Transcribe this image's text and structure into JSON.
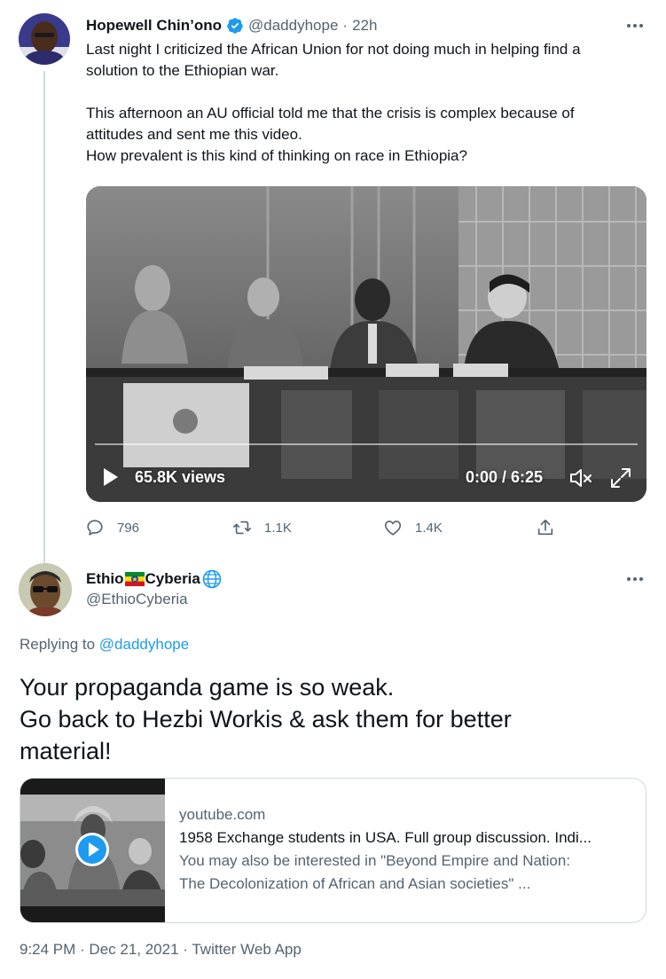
{
  "tweet": {
    "author_name": "Hopewell Chin’ono",
    "handle": "@daddyhope",
    "separator": "·",
    "time": "22h",
    "text_lines": [
      "Last night I criticized the African Union for not doing much in helping find a",
      "solution to the Ethiopian war.",
      "",
      "This afternoon an AU official told me that the crisis is complex because of",
      "attitudes and sent me this video.",
      "How prevalent is this kind of thinking on race in Ethiopia?"
    ],
    "video": {
      "views": "65.8K views",
      "time_display": "0:00 / 6:25"
    },
    "stats": {
      "replies": "796",
      "retweets": "1.1K",
      "likes": "1.4K"
    }
  },
  "reply": {
    "name_part1": "Ethio",
    "name_part2": "Cyberia",
    "handle": "@EthioCyberia",
    "replying_prefix": "Replying to",
    "replying_to": "@daddyhope",
    "text_lines": [
      "Your propaganda game is so weak.",
      "Go back to Hezbi Workis & ask them for better",
      "material!"
    ],
    "card": {
      "domain": "youtube.com",
      "title": "1958 Exchange students in USA. Full group discussion. Indi...",
      "description_lines": [
        "You may also be interested in \"Beyond Empire and Nation:",
        "The Decolonization of African and Asian societies\" ..."
      ]
    },
    "footer": "9:24 PM · Dec 21, 2021 · Twitter Web App"
  },
  "colors": {
    "accent": "#1d9bf0",
    "text_primary": "#0f1419",
    "text_secondary": "#536471",
    "border": "#cfd9de"
  },
  "icons": [
    "verified-badge-icon",
    "more-icon",
    "play-icon",
    "mute-icon",
    "fullscreen-icon",
    "reply-icon",
    "retweet-icon",
    "like-icon",
    "share-icon",
    "ethiopia-flag-icon",
    "globe-icon",
    "youtube-play-icon"
  ]
}
